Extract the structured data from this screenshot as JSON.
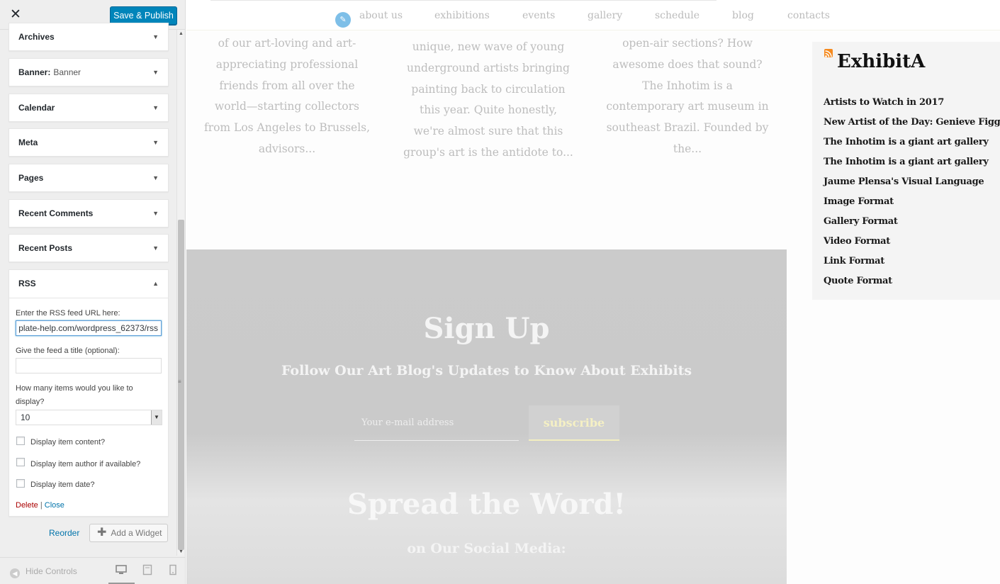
{
  "customizer": {
    "close_icon": "close-icon",
    "save_label": "Save & Publish",
    "widgets": [
      {
        "title": "Archives",
        "subtitle": ""
      },
      {
        "title": "Banner:",
        "subtitle": "Banner"
      },
      {
        "title": "Calendar",
        "subtitle": ""
      },
      {
        "title": "Meta",
        "subtitle": ""
      },
      {
        "title": "Pages",
        "subtitle": ""
      },
      {
        "title": "Recent Comments",
        "subtitle": ""
      },
      {
        "title": "Recent Posts",
        "subtitle": ""
      },
      {
        "title": "RSS",
        "subtitle": ""
      }
    ],
    "rss_form": {
      "url_label": "Enter the RSS feed URL here:",
      "url_value": "plate-help.com/wordpress_62373/rss",
      "title_label": "Give the feed a title (optional):",
      "title_value": "",
      "items_label": "How many items would you like to display?",
      "items_value": "10",
      "content_label": "Display item content?",
      "author_label": "Display item author if available?",
      "date_label": "Display item date?",
      "delete_label": "Delete",
      "separator": "|",
      "close_label": "Close"
    },
    "reorder_label": "Reorder",
    "add_widget_label": "Add a Widget",
    "hide_controls_label": "Hide Controls",
    "devices": [
      "desktop-icon",
      "tablet-icon",
      "mobile-icon"
    ]
  },
  "preview": {
    "nav": [
      "about us",
      "exhibitions",
      "events",
      "gallery",
      "schedule",
      "blog",
      "contacts"
    ],
    "excerpts": [
      "of our art-loving and art-appreciating professional friends from all over the world—starting collectors from Los Angeles to Brussels, advisors...",
      "unique, new wave of young underground artists bringing painting back to circulation this year. Quite honestly, we're almost sure that this group's art is the antidote to...",
      "open-air sections? How awesome does that sound? The Inhotim is a contemporary art museum in southeast Brazil. Founded by the..."
    ],
    "signup": {
      "title": "Sign Up",
      "subtitle": "Follow Our Art Blog's Updates to Know About Exhibits",
      "email_placeholder": "Your e-mail address",
      "subscribe_label": "subscribe",
      "spread_title": "Spread the Word!",
      "spread_subtitle": "on Our Social Media:"
    },
    "rss_widget": {
      "title": "ExhibitA",
      "items": [
        "Artists to Watch in 2017",
        "New Artist of the Day: Genieve Figgis",
        "The Inhotim is a giant art gallery",
        "The Inhotim is a giant art gallery",
        "Jaume Plensa's Visual Language",
        "Image Format",
        "Gallery Format",
        "Video Format",
        "Link Format",
        "Quote Format"
      ]
    }
  },
  "colors": {
    "primary_button": "#0085ba",
    "link": "#0073aa",
    "delete": "#aa0000",
    "rss_icon": "#f58a1f"
  }
}
